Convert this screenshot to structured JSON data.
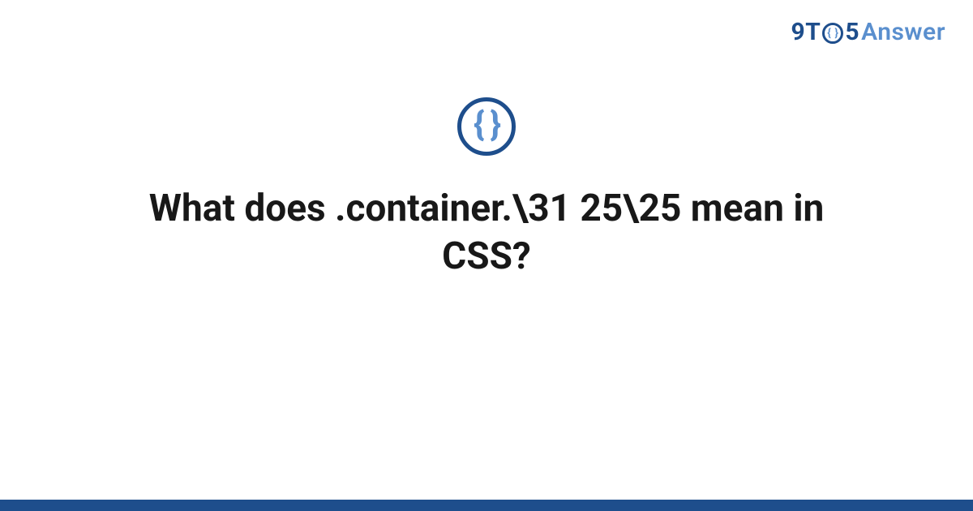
{
  "brand": {
    "nine": "9",
    "t": "T",
    "o_glyph": "{ }",
    "five": "5",
    "answer": "Answer"
  },
  "badge": {
    "glyph": "{ }"
  },
  "question": {
    "title": "What does .container.\\31 25\\25 mean in CSS?"
  },
  "colors": {
    "primary": "#1e4e8c",
    "accent": "#5a8fce",
    "text": "#181818",
    "background": "#ffffff"
  }
}
